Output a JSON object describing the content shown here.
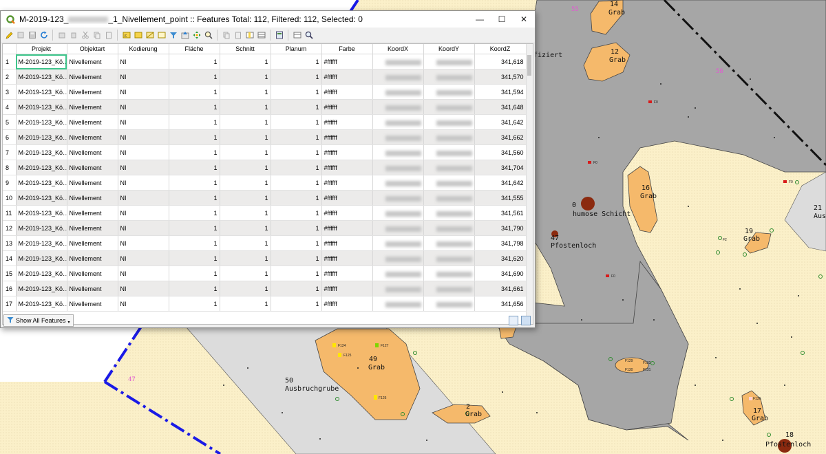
{
  "window": {
    "title_prefix": "M-2019-123_",
    "title_suffix": "_1_Nivellement_point :: Features Total: 112, Filtered: 112, Selected: 0",
    "minimize": "—",
    "maximize": "☐",
    "close": "✕"
  },
  "table": {
    "columns": [
      "Projekt",
      "Objektart",
      "Kodierung",
      "Fläche",
      "Schnitt",
      "Planum",
      "Farbe",
      "KoordX",
      "KoordY",
      "KoordZ"
    ],
    "rows": [
      {
        "n": "1",
        "projekt": "M-2019-123_Kö...",
        "objektart": "Nivellement",
        "kodierung": "NI",
        "flaeche": "1",
        "schnitt": "1",
        "planum": "1",
        "farbe": "#ffffff",
        "z": "341,618"
      },
      {
        "n": "2",
        "projekt": "M-2019-123_Kö...",
        "objektart": "Nivellement",
        "kodierung": "NI",
        "flaeche": "1",
        "schnitt": "1",
        "planum": "1",
        "farbe": "#ffffff",
        "z": "341,570"
      },
      {
        "n": "3",
        "projekt": "M-2019-123_Kö...",
        "objektart": "Nivellement",
        "kodierung": "NI",
        "flaeche": "1",
        "schnitt": "1",
        "planum": "1",
        "farbe": "#ffffff",
        "z": "341,594"
      },
      {
        "n": "4",
        "projekt": "M-2019-123_Kö...",
        "objektart": "Nivellement",
        "kodierung": "NI",
        "flaeche": "1",
        "schnitt": "1",
        "planum": "1",
        "farbe": "#ffffff",
        "z": "341,648"
      },
      {
        "n": "5",
        "projekt": "M-2019-123_Kö...",
        "objektart": "Nivellement",
        "kodierung": "NI",
        "flaeche": "1",
        "schnitt": "1",
        "planum": "1",
        "farbe": "#ffffff",
        "z": "341,642"
      },
      {
        "n": "6",
        "projekt": "M-2019-123_Kö...",
        "objektart": "Nivellement",
        "kodierung": "NI",
        "flaeche": "1",
        "schnitt": "1",
        "planum": "1",
        "farbe": "#ffffff",
        "z": "341,662"
      },
      {
        "n": "7",
        "projekt": "M-2019-123_Kö...",
        "objektart": "Nivellement",
        "kodierung": "NI",
        "flaeche": "1",
        "schnitt": "1",
        "planum": "1",
        "farbe": "#ffffff",
        "z": "341,560"
      },
      {
        "n": "8",
        "projekt": "M-2019-123_Kö...",
        "objektart": "Nivellement",
        "kodierung": "NI",
        "flaeche": "1",
        "schnitt": "1",
        "planum": "1",
        "farbe": "#ffffff",
        "z": "341,704"
      },
      {
        "n": "9",
        "projekt": "M-2019-123_Kö...",
        "objektart": "Nivellement",
        "kodierung": "NI",
        "flaeche": "1",
        "schnitt": "1",
        "planum": "1",
        "farbe": "#ffffff",
        "z": "341,642"
      },
      {
        "n": "10",
        "projekt": "M-2019-123_Kö...",
        "objektart": "Nivellement",
        "kodierung": "NI",
        "flaeche": "1",
        "schnitt": "1",
        "planum": "1",
        "farbe": "#ffffff",
        "z": "341,555"
      },
      {
        "n": "11",
        "projekt": "M-2019-123_Kö...",
        "objektart": "Nivellement",
        "kodierung": "NI",
        "flaeche": "1",
        "schnitt": "1",
        "planum": "1",
        "farbe": "#ffffff",
        "z": "341,561"
      },
      {
        "n": "12",
        "projekt": "M-2019-123_Kö...",
        "objektart": "Nivellement",
        "kodierung": "NI",
        "flaeche": "1",
        "schnitt": "1",
        "planum": "1",
        "farbe": "#ffffff",
        "z": "341,790"
      },
      {
        "n": "13",
        "projekt": "M-2019-123_Kö...",
        "objektart": "Nivellement",
        "kodierung": "NI",
        "flaeche": "1",
        "schnitt": "1",
        "planum": "1",
        "farbe": "#ffffff",
        "z": "341,798"
      },
      {
        "n": "14",
        "projekt": "M-2019-123_Kö...",
        "objektart": "Nivellement",
        "kodierung": "NI",
        "flaeche": "1",
        "schnitt": "1",
        "planum": "1",
        "farbe": "#ffffff",
        "z": "341,620"
      },
      {
        "n": "15",
        "projekt": "M-2019-123_Kö...",
        "objektart": "Nivellement",
        "kodierung": "NI",
        "flaeche": "1",
        "schnitt": "1",
        "planum": "1",
        "farbe": "#ffffff",
        "z": "341,690"
      },
      {
        "n": "16",
        "projekt": "M-2019-123_Kö...",
        "objektart": "Nivellement",
        "kodierung": "NI",
        "flaeche": "1",
        "schnitt": "1",
        "planum": "1",
        "farbe": "#ffffff",
        "z": "341,661"
      },
      {
        "n": "17",
        "projekt": "M-2019-123_Kö...",
        "objektart": "Nivellement",
        "kodierung": "NI",
        "flaeche": "1",
        "schnitt": "1",
        "planum": "1",
        "farbe": "#ffffff",
        "z": "341,656"
      }
    ]
  },
  "bottom": {
    "show_all_label": "Show All Features"
  },
  "map": {
    "labels": {
      "f14n": "14",
      "f14t": "Grab",
      "f12n": "12",
      "f12t": "Grab",
      "fizt": "fiziert",
      "f16n": "16",
      "f16t": "Grab",
      "f0n": "0",
      "f0t": "humose Schicht",
      "f47n": "47",
      "f47t": "Pfostenloch",
      "f19n": "19",
      "f19t": "Grab",
      "f21n": "21",
      "f21t": "Aus",
      "f49n": "49",
      "f49t": "Grab",
      "f50n": "50",
      "f50t": "Ausbruchgrube",
      "f2n": "2",
      "f2t": "Grab",
      "f17n": "17",
      "f17t": "Grab",
      "f18n": "18",
      "f18t": "Pfostenloch",
      "p55": "55",
      "p56": "56",
      "p47": "47",
      "F0": "F0",
      "F2": "F2",
      "F124": "F124",
      "F125": "F125",
      "F127": "F127",
      "F126": "F126",
      "F129": "F129",
      "F130": "F130",
      "F131": "F131",
      "F132": "F132",
      "F136": "F136"
    },
    "colors": {
      "soil": "#fbf0c9",
      "grey": "#a6a6a6",
      "light": "#dcdcdc",
      "grave": "#f5b96b",
      "boundary": "#1a1ae6",
      "post": "#8b2a0f",
      "marker": "#2e8b2e"
    }
  }
}
